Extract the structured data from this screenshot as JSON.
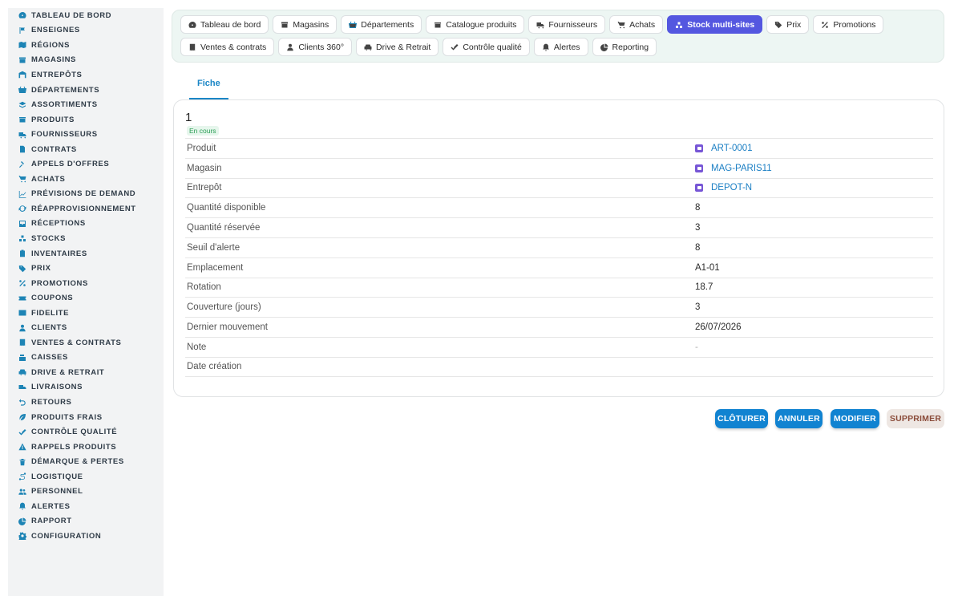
{
  "sidebar": {
    "items": [
      {
        "label": "TABLEAU DE BORD",
        "icon": "dashboard-icon"
      },
      {
        "label": "ENSEIGNES",
        "icon": "flag-icon"
      },
      {
        "label": "RÉGIONS",
        "icon": "map-icon"
      },
      {
        "label": "MAGASINS",
        "icon": "store-icon"
      },
      {
        "label": "ENTREPÔTS",
        "icon": "warehouse-icon"
      },
      {
        "label": "DÉPARTEMENTS",
        "icon": "basket-icon"
      },
      {
        "label": "ASSORTIMENTS",
        "icon": "layers-icon"
      },
      {
        "label": "PRODUITS",
        "icon": "box-icon"
      },
      {
        "label": "FOURNISSEURS",
        "icon": "truck-icon"
      },
      {
        "label": "CONTRATS",
        "icon": "document-icon"
      },
      {
        "label": "APPELS D'OFFRES",
        "icon": "gavel-icon"
      },
      {
        "label": "ACHATS",
        "icon": "cart-icon"
      },
      {
        "label": "PRÉVISIONS DE DEMAND",
        "icon": "chart-line-icon"
      },
      {
        "label": "RÉAPPROVISIONNEMENT",
        "icon": "refresh-icon"
      },
      {
        "label": "RÉCEPTIONS",
        "icon": "inbox-icon"
      },
      {
        "label": "STOCKS",
        "icon": "stack-icon"
      },
      {
        "label": "INVENTAIRES",
        "icon": "clipboard-icon"
      },
      {
        "label": "PRIX",
        "icon": "tag-icon"
      },
      {
        "label": "PROMOTIONS",
        "icon": "percent-icon"
      },
      {
        "label": "COUPONS",
        "icon": "ticket-icon"
      },
      {
        "label": "FIDELITE",
        "icon": "card-icon"
      },
      {
        "label": "CLIENTS",
        "icon": "user-icon"
      },
      {
        "label": "VENTES & CONTRATS",
        "icon": "receipt-icon"
      },
      {
        "label": "CAISSES",
        "icon": "cash-register-icon"
      },
      {
        "label": "DRIVE & RETRAIT",
        "icon": "car-icon"
      },
      {
        "label": "LIVRAISONS",
        "icon": "delivery-truck-icon"
      },
      {
        "label": "RETOURS",
        "icon": "undo-icon"
      },
      {
        "label": "PRODUITS FRAIS",
        "icon": "leaf-icon"
      },
      {
        "label": "CONTRÔLE QUALITÉ",
        "icon": "check-double-icon"
      },
      {
        "label": "RAPPELS PRODUITS",
        "icon": "warning-icon"
      },
      {
        "label": "DÉMARQUE & PERTES",
        "icon": "trash-icon"
      },
      {
        "label": "LOGISTIQUE",
        "icon": "route-icon"
      },
      {
        "label": "PERSONNEL",
        "icon": "users-icon"
      },
      {
        "label": "ALERTES",
        "icon": "bell-icon"
      },
      {
        "label": "RAPPORT",
        "icon": "pie-chart-icon"
      },
      {
        "label": "CONFIGURATION",
        "icon": "gear-icon"
      }
    ]
  },
  "topnav": {
    "items": [
      {
        "label": "Tableau de bord",
        "icon": "dashboard-icon",
        "active": false
      },
      {
        "label": "Magasins",
        "icon": "store-icon",
        "active": false
      },
      {
        "label": "Départements",
        "icon": "basket-icon",
        "active": false
      },
      {
        "label": "Catalogue produits",
        "icon": "box-icon",
        "active": false
      },
      {
        "label": "Fournisseurs",
        "icon": "truck-icon",
        "active": false
      },
      {
        "label": "Achats",
        "icon": "cart-icon",
        "active": false
      },
      {
        "label": "Stock multi-sites",
        "icon": "stack-icon",
        "active": true
      },
      {
        "label": "Prix",
        "icon": "tag-icon",
        "active": false
      },
      {
        "label": "Promotions",
        "icon": "percent-icon",
        "active": false
      },
      {
        "label": "Ventes & contrats",
        "icon": "receipt-icon",
        "active": false
      },
      {
        "label": "Clients 360°",
        "icon": "user-icon",
        "active": false
      },
      {
        "label": "Drive & Retrait",
        "icon": "car-icon",
        "active": false
      },
      {
        "label": "Contrôle qualité",
        "icon": "check-double-icon",
        "active": false
      },
      {
        "label": "Alertes",
        "icon": "bell-icon",
        "active": false
      },
      {
        "label": "Reporting",
        "icon": "pie-chart-icon",
        "active": false
      }
    ]
  },
  "tabs": {
    "fiche": "Fiche"
  },
  "record": {
    "title": "1",
    "status": "En cours",
    "fields": [
      {
        "label": "Produit",
        "value": "ART-0001",
        "type": "link"
      },
      {
        "label": "Magasin",
        "value": "MAG-PARIS11",
        "type": "link"
      },
      {
        "label": "Entrepôt",
        "value": "DEPOT-N",
        "type": "link"
      },
      {
        "label": "Quantité disponible",
        "value": "8",
        "type": "text"
      },
      {
        "label": "Quantité réservée",
        "value": "3",
        "type": "text"
      },
      {
        "label": "Seuil d'alerte",
        "value": "8",
        "type": "text"
      },
      {
        "label": "Emplacement",
        "value": "A1-01",
        "type": "text"
      },
      {
        "label": "Rotation",
        "value": "18.7",
        "type": "text"
      },
      {
        "label": "Couverture (jours)",
        "value": "3",
        "type": "text"
      },
      {
        "label": "Dernier mouvement",
        "value": "26/07/2026",
        "type": "text"
      },
      {
        "label": "Note",
        "value": "-",
        "type": "muted"
      },
      {
        "label": "Date création",
        "value": "",
        "type": "text"
      }
    ]
  },
  "actions": {
    "cloturer": "CLÔTURER",
    "annuler": "ANNULER",
    "modifier": "MODIFIER",
    "supprimer": "SUPPRIMER"
  },
  "colors": {
    "accent": "#1183d1",
    "active_nav": "#5457e0",
    "status_green": "#2a9d55",
    "link_chip": "#7756d6"
  }
}
